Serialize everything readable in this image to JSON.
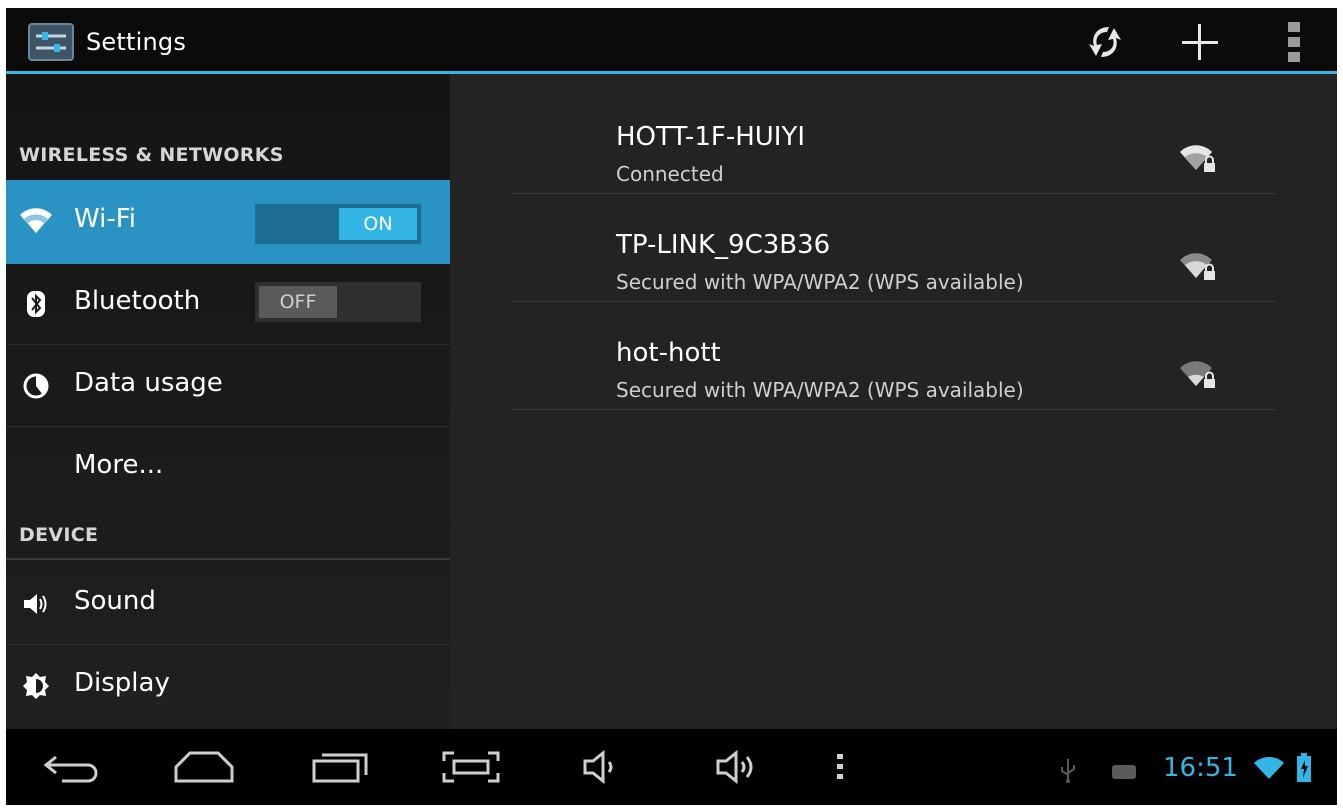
{
  "app": {
    "title": "Settings",
    "accent_color": "#33b5e5",
    "selected_bg": "#2a93c4"
  },
  "actionbar": {
    "icons": [
      "settings-app-icon",
      "wps-refresh-icon",
      "add-network-icon",
      "overflow-menu-icon"
    ]
  },
  "sidebar": {
    "sections": [
      {
        "header": "WIRELESS & NETWORKS"
      },
      {
        "header": "DEVICE"
      }
    ],
    "items": [
      {
        "label": "Wi-Fi",
        "icon": "wifi-icon",
        "selected": true,
        "toggle": "ON"
      },
      {
        "label": "Bluetooth",
        "icon": "bluetooth-icon",
        "selected": false,
        "toggle": "OFF"
      },
      {
        "label": "Data usage",
        "icon": "data-usage-icon",
        "selected": false
      },
      {
        "label": "More...",
        "icon": "",
        "selected": false
      },
      {
        "label": "Sound",
        "icon": "speaker-icon",
        "selected": false
      },
      {
        "label": "Display",
        "icon": "brightness-icon",
        "selected": false
      }
    ]
  },
  "networks": [
    {
      "ssid": "HOTT-1F-HUIYI",
      "status": "Connected",
      "icon": "wifi-lock-icon"
    },
    {
      "ssid": "TP-LINK_9C3B36",
      "status": "Secured with WPA/WPA2 (WPS available)",
      "icon": "wifi-lock-icon"
    },
    {
      "ssid": "hot-hott",
      "status": "Secured with WPA/WPA2 (WPS available)",
      "icon": "wifi-lock-icon"
    }
  ],
  "navbar": {
    "buttons": [
      "back-icon",
      "home-icon",
      "recent-apps-icon",
      "screenshot-icon",
      "volume-down-icon",
      "volume-up-icon",
      "menu-dots-icon"
    ],
    "status_icons": [
      "usb-icon",
      "android-debug-icon",
      "wifi-status-icon",
      "battery-icon"
    ],
    "time": "16:51"
  }
}
